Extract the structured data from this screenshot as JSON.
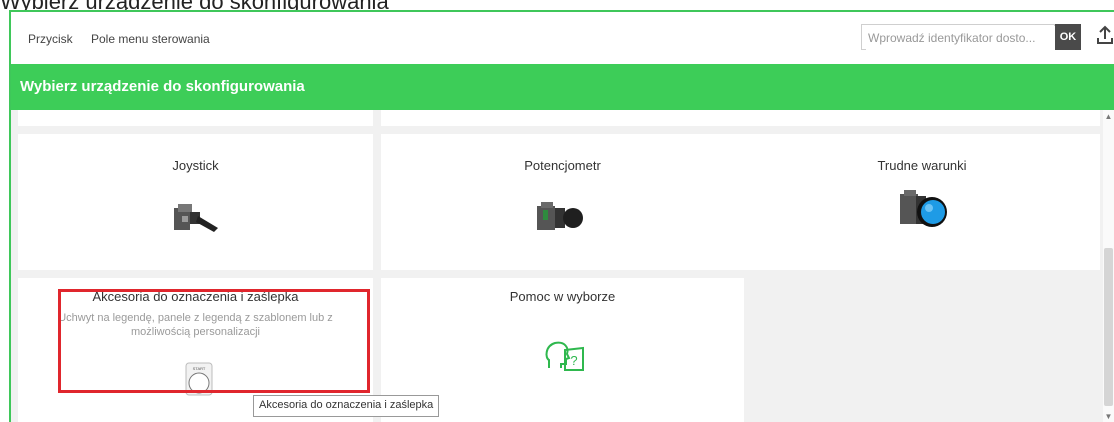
{
  "page_heading_cut": "Wybierz urządzenie do skonfigurowania",
  "menu": {
    "item1": "Przycisk",
    "item2": "Pole menu sterowania"
  },
  "search": {
    "placeholder": "Wprowadź identyfikator dosto...",
    "ok_label": "OK"
  },
  "banner": {
    "title": "Wybierz urządzenie do skonfigurowania"
  },
  "cards": [
    {
      "title": "Joystick",
      "icon": "joystick-icon"
    },
    {
      "title": "Potencjometr",
      "icon": "potentiometer-icon"
    },
    {
      "title": "Trudne warunki",
      "icon": "pushbutton-blue-icon"
    },
    {
      "title": "Akcesoria do oznaczenia i zaślepka",
      "description": "Uchwyt na legendę, panele z legendą z szablonem lub z możliwością personalizacji",
      "icon": "legend-holder-icon"
    },
    {
      "title": "Pomoc w wyborze",
      "icon": "help-head-icon"
    }
  ],
  "tooltip": "Akcesoria do oznaczenia i zaślepka",
  "legend_plate_text": "START",
  "colors": {
    "accent": "#3dcd58",
    "highlight": "#e0262d",
    "help_icon": "#2fb84e",
    "button_blue": "#1e9be6"
  }
}
